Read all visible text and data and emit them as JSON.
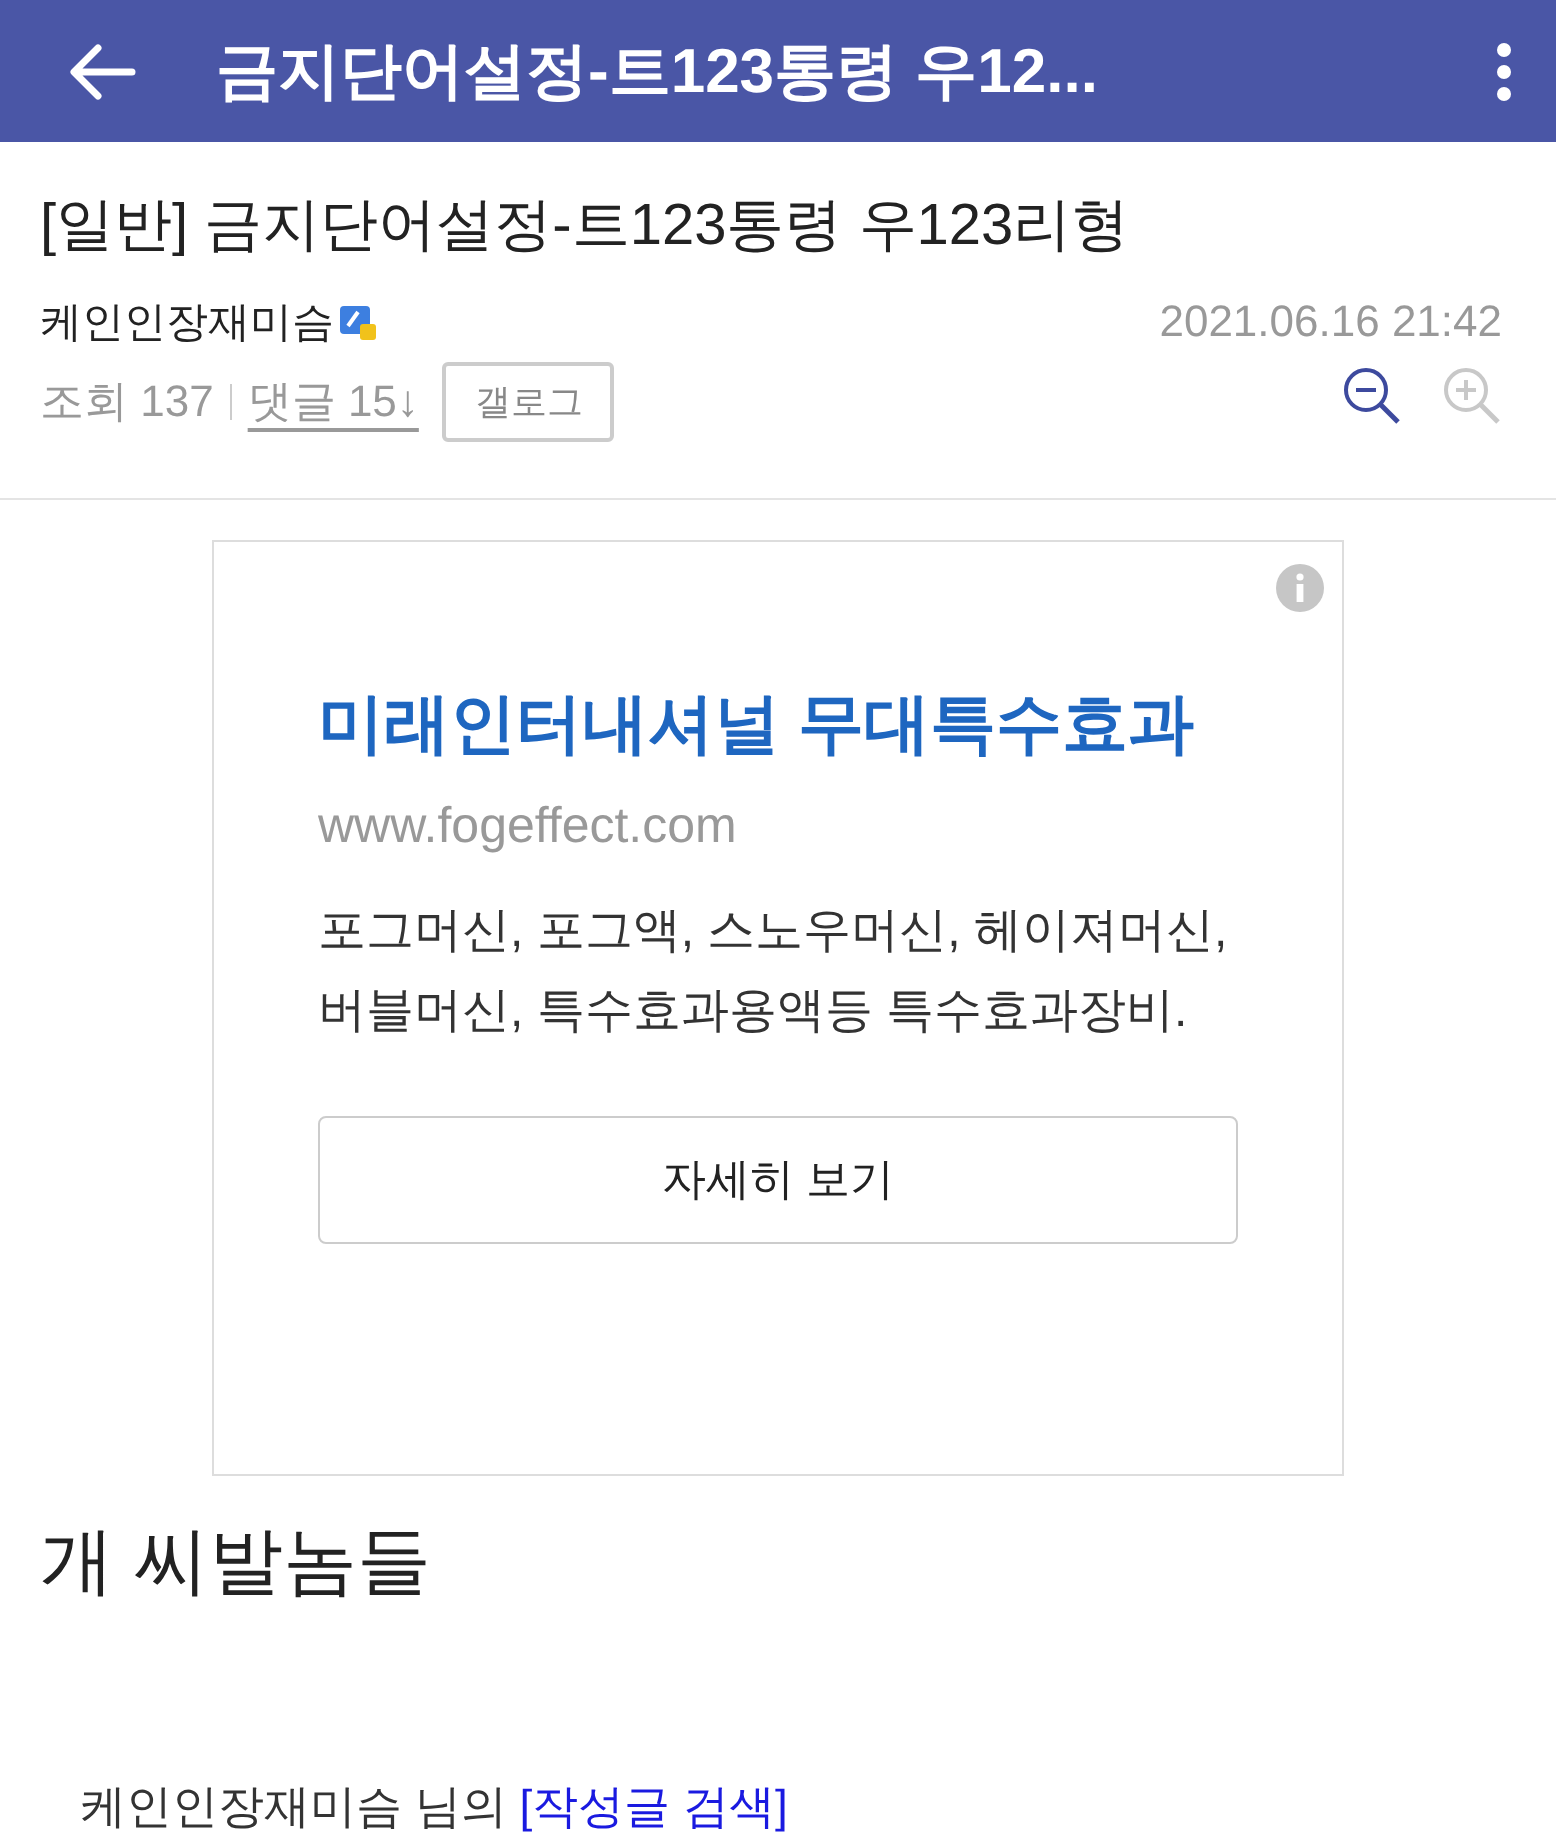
{
  "app_bar": {
    "title": "금지단어설정-트123통령 우12..."
  },
  "post": {
    "title": "[일반] 금지단어설정-트123통령 우123리형",
    "author": "케인인장재미슴",
    "date": "2021.06.16 21:42",
    "views_label": "조회 137",
    "comments_link": "댓글 15↓",
    "gallog_button": "갤로그",
    "zoom_buttons": [
      {
        "kind": "zoom-out",
        "disabled": false
      },
      {
        "kind": "zoom-in",
        "disabled": true
      }
    ]
  },
  "ad": {
    "headline": "미래인터내셔널 무대특수효과",
    "url": "www.fogeffect.com",
    "description": "포그머신, 포그액, 스노우머신, 헤이져머신, 버블머신, 특수효과용액등 특수효과장비.",
    "button": "자세히 보기"
  },
  "body": {
    "text": "개 씨발놈들"
  },
  "footer": {
    "text": "케인인장재미슴 님의",
    "link": "[작성글 검색]"
  }
}
